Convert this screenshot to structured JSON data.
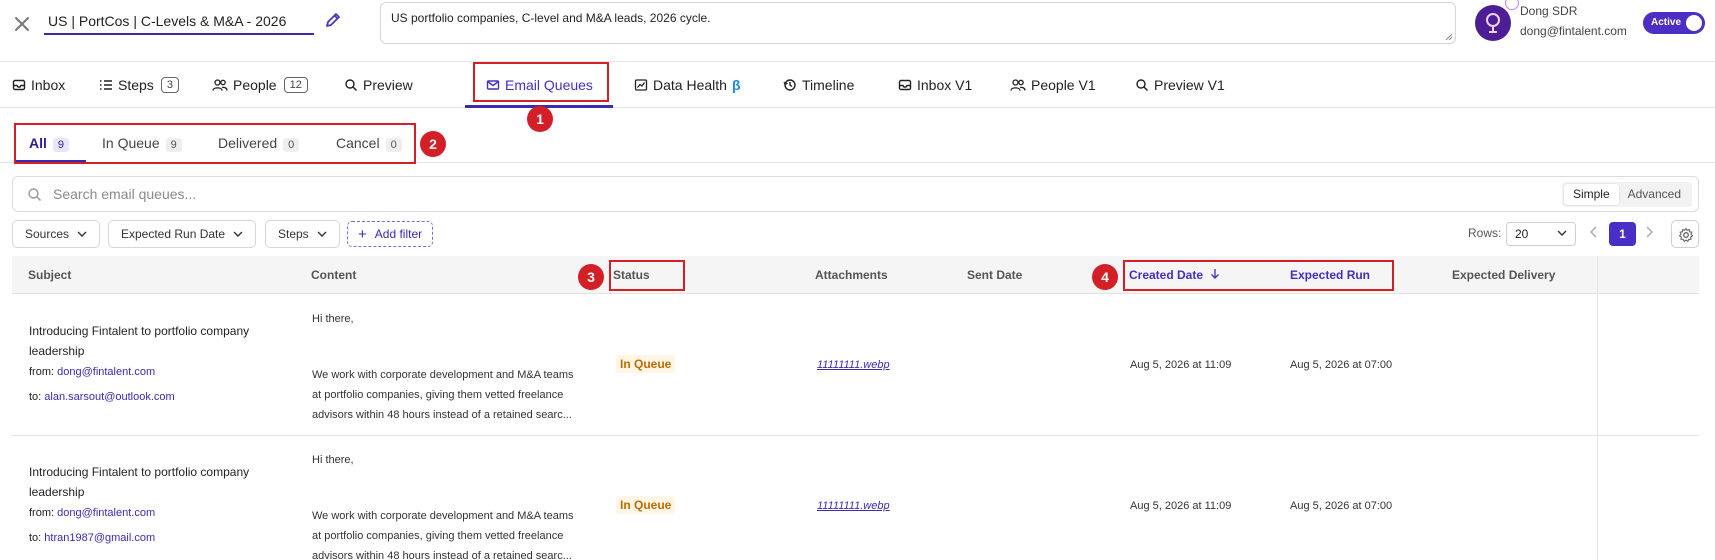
{
  "header": {
    "title": "US | PortCos | C-Levels & M&A - 2026",
    "description": "US portfolio companies, C-level and M&A leads, 2026 cycle.",
    "user_name": "Dong SDR",
    "user_email": "dong@fintalent.com",
    "status_toggle": "Active"
  },
  "main_tabs": [
    {
      "label": "Inbox",
      "icon": "inbox-icon"
    },
    {
      "label": "Steps",
      "count": "3",
      "icon": "list-icon"
    },
    {
      "label": "People",
      "count": "12",
      "icon": "people-icon"
    },
    {
      "label": "Preview",
      "icon": "search-icon"
    },
    {
      "label": "Email Queues",
      "icon": "mail-icon",
      "active": true
    },
    {
      "label": "Data Health",
      "suffix": "β",
      "icon": "chart-icon"
    },
    {
      "label": "Timeline",
      "icon": "history-icon"
    },
    {
      "label": "Inbox V1",
      "icon": "inbox-icon"
    },
    {
      "label": "People V1",
      "icon": "people-icon"
    },
    {
      "label": "Preview V1",
      "icon": "search-icon"
    }
  ],
  "annotations": [
    "1",
    "2",
    "3",
    "4"
  ],
  "sub_tabs": [
    {
      "label": "All",
      "count": "9",
      "active": true
    },
    {
      "label": "In Queue",
      "count": "9"
    },
    {
      "label": "Delivered",
      "count": "0"
    },
    {
      "label": "Cancel",
      "count": "0"
    }
  ],
  "search": {
    "placeholder": "Search email queues...",
    "mode_simple": "Simple",
    "mode_advanced": "Advanced"
  },
  "filters": {
    "sources": "Sources",
    "expected_run_date": "Expected Run Date",
    "steps": "Steps",
    "add_filter": "Add filter",
    "rows_label": "Rows:",
    "rows_value": "20",
    "page": "1"
  },
  "table": {
    "headers": {
      "subject": "Subject",
      "content": "Content",
      "status": "Status",
      "attachments": "Attachments",
      "sent_date": "Sent Date",
      "created_date": "Created Date",
      "expected_run": "Expected Run",
      "expected_delivery": "Expected Delivery"
    },
    "rows": [
      {
        "subject": "Introducing Fintalent to portfolio company leadership",
        "from_label": "from:",
        "from": "dong@fintalent.com",
        "to_label": "to:",
        "to": "alan.sarsout@outlook.com",
        "greeting": "Hi there,",
        "body": "We work with corporate development and M&A teams at portfolio companies, giving them vetted freelance advisors within 48 hours instead of a retained searc...",
        "status": "In Queue",
        "attachment": "11111111.webp",
        "created": "Aug 5, 2026 at 11:09",
        "expected": "Aug 5, 2026 at 07:00"
      },
      {
        "subject": "Introducing Fintalent to portfolio company leadership",
        "from_label": "from:",
        "from": "dong@fintalent.com",
        "to_label": "to:",
        "to": "htran1987@gmail.com",
        "greeting": "Hi there,",
        "body": "We work with corporate development and M&A teams at portfolio companies, giving them vetted freelance advisors within 48 hours instead of a retained searc...",
        "status": "In Queue",
        "attachment": "11111111.webp",
        "created": "Aug 5, 2026 at 11:09",
        "expected": "Aug 5, 2026 at 07:00"
      }
    ]
  },
  "colors": {
    "accent": "#3b2bb0",
    "annotation": "#d32027",
    "status_queue": "#c26a00"
  }
}
